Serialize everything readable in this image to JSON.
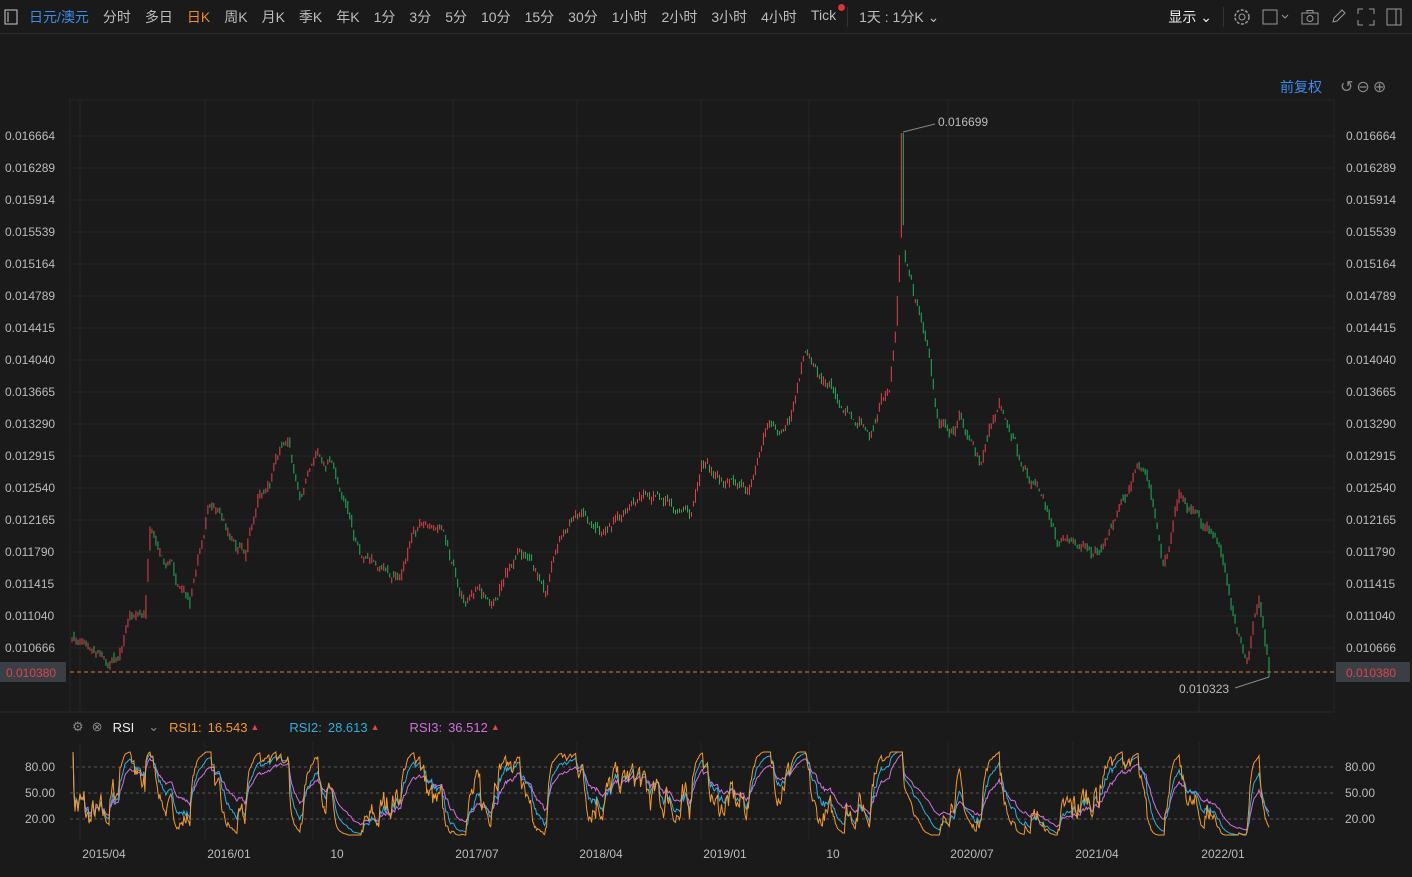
{
  "toolbar": {
    "symbol": "日元/澳元",
    "periods": [
      "分时",
      "多日",
      "日K",
      "周K",
      "月K",
      "季K",
      "年K",
      "1分",
      "3分",
      "5分",
      "10分",
      "15分",
      "30分",
      "1小时",
      "2小时",
      "3小时",
      "4小时",
      "Tick"
    ],
    "active": "日K",
    "multi": "1天 : 1分K",
    "display": "显示"
  },
  "adjust": "前复权",
  "colors": {
    "up": "#e0434b",
    "down": "#1db35a",
    "rsi1": "#f39a2b",
    "rsi2": "#2bb0e0",
    "rsi3": "#d26ee0",
    "accent": "#3d8bea"
  },
  "price_axis": [
    "0.016664",
    "0.016289",
    "0.015914",
    "0.015539",
    "0.015164",
    "0.014789",
    "0.014415",
    "0.014040",
    "0.013665",
    "0.013290",
    "0.012915",
    "0.012540",
    "0.012165",
    "0.011790",
    "0.011415",
    "0.011040",
    "0.010666"
  ],
  "last_price": "0.010380",
  "max_label": "0.016699",
  "min_label": "0.010323",
  "rsi": {
    "name": "RSI",
    "rsi1_label": "RSI1:",
    "rsi1": "16.543",
    "rsi2_label": "RSI2:",
    "rsi2": "28.613",
    "rsi3_label": "RSI3:",
    "rsi3": "36.512",
    "axis": [
      "80.00",
      "50.00",
      "20.00"
    ]
  },
  "time_axis": [
    "2015/04",
    "2016/01",
    "10",
    "2017/07",
    "2018/04",
    "2019/01",
    "10",
    "2020/07",
    "2021/04",
    "2022/01"
  ],
  "chart_data": {
    "type": "candlestick",
    "series": "JPY/AUD daily",
    "y_range": [
      0.010323,
      0.016699
    ],
    "keypoints": [
      [
        0,
        0.010816
      ],
      [
        33,
        0.010465
      ],
      [
        46,
        0.010523
      ],
      [
        58,
        0.011109
      ],
      [
        73,
        0.010992
      ],
      [
        78,
        0.012047
      ],
      [
        93,
        0.011695
      ],
      [
        118,
        0.011226
      ],
      [
        138,
        0.012398
      ],
      [
        158,
        0.01193
      ],
      [
        173,
        0.011695
      ],
      [
        186,
        0.012398
      ],
      [
        203,
        0.01275
      ],
      [
        216,
        0.013219
      ],
      [
        228,
        0.012398
      ],
      [
        243,
        0.012984
      ],
      [
        258,
        0.012867
      ],
      [
        288,
        0.011695
      ],
      [
        308,
        0.011578
      ],
      [
        328,
        0.011519
      ],
      [
        348,
        0.012164
      ],
      [
        373,
        0.01193
      ],
      [
        388,
        0.011344
      ],
      [
        418,
        0.011226
      ],
      [
        448,
        0.011812
      ],
      [
        473,
        0.011285
      ],
      [
        488,
        0.01193
      ],
      [
        508,
        0.012281
      ],
      [
        538,
        0.012047
      ],
      [
        568,
        0.012398
      ],
      [
        598,
        0.012398
      ],
      [
        618,
        0.012164
      ],
      [
        630,
        0.012867
      ],
      [
        648,
        0.012633
      ],
      [
        678,
        0.012516
      ],
      [
        693,
        0.013219
      ],
      [
        718,
        0.013336
      ],
      [
        733,
        0.014039
      ],
      [
        758,
        0.013687
      ],
      [
        778,
        0.013453
      ],
      [
        798,
        0.013219
      ],
      [
        818,
        0.013805
      ],
      [
        825,
        0.014508
      ],
      [
        831,
        0.015914
      ],
      [
        833,
        0.015328
      ],
      [
        843,
        0.014742
      ],
      [
        858,
        0.014156
      ],
      [
        868,
        0.013219
      ],
      [
        888,
        0.013336
      ],
      [
        908,
        0.012867
      ],
      [
        928,
        0.01357
      ],
      [
        948,
        0.012867
      ],
      [
        968,
        0.012516
      ],
      [
        988,
        0.011871
      ],
      [
        1028,
        0.011812
      ],
      [
        1048,
        0.012281
      ],
      [
        1066,
        0.01275
      ],
      [
        1078,
        0.012516
      ],
      [
        1093,
        0.011695
      ],
      [
        1108,
        0.012398
      ],
      [
        1128,
        0.012164
      ],
      [
        1148,
        0.01193
      ],
      [
        1163,
        0.010992
      ],
      [
        1176,
        0.010523
      ],
      [
        1188,
        0.011226
      ],
      [
        1196,
        0.010523
      ],
      [
        1198,
        0.01038
      ]
    ]
  }
}
